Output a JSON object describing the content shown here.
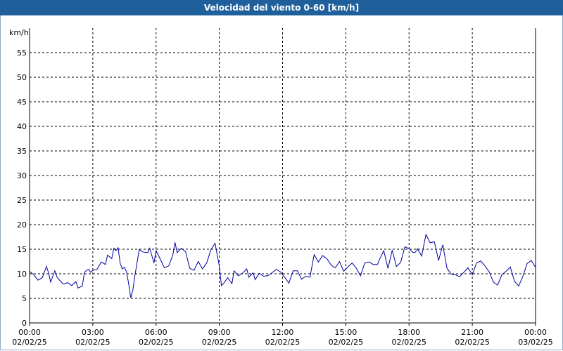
{
  "window": {
    "title": "Velocidad del viento 0-60 [km/h]"
  },
  "colors": {
    "title_bar": "#1f5f9b",
    "series": "#0000a0",
    "grid": "#000000",
    "background": "#ffffff"
  },
  "chart_data": {
    "type": "line",
    "title": "Velocidad del viento 0-60 [km/h]",
    "ylabel": "km/h",
    "ylim": [
      0,
      60
    ],
    "y_ticks": [
      "0",
      "5",
      "10",
      "15",
      "20",
      "25",
      "30",
      "35",
      "40",
      "45",
      "50",
      "55"
    ],
    "x_ticks": [
      {
        "time": "00:00",
        "date": "02/02/25"
      },
      {
        "time": "03:00",
        "date": "02/02/25"
      },
      {
        "time": "06:00",
        "date": "02/02/25"
      },
      {
        "time": "09:00",
        "date": "02/02/25"
      },
      {
        "time": "12:00",
        "date": "02/02/25"
      },
      {
        "time": "15:00",
        "date": "02/02/25"
      },
      {
        "time": "18:00",
        "date": "02/02/25"
      },
      {
        "time": "21:00",
        "date": "02/02/25"
      },
      {
        "time": "00:00",
        "date": "03/02/25"
      }
    ],
    "grid": true,
    "xlim_hours": [
      0,
      24
    ],
    "series": [
      {
        "x_hours": [
          0.0,
          0.2,
          0.4,
          0.6,
          0.8,
          0.9,
          1.0,
          1.2,
          1.3,
          1.4,
          1.6,
          1.8,
          2.0,
          2.2,
          2.3,
          2.5,
          2.6,
          2.7,
          2.8,
          2.9,
          3.0,
          3.2,
          3.4,
          3.6,
          3.7,
          3.9,
          4.0,
          4.1,
          4.2,
          4.3,
          4.4,
          4.5,
          4.6,
          4.7,
          4.8,
          4.9,
          5.0,
          5.2,
          5.4,
          5.6,
          5.7,
          5.9,
          6.0,
          6.2,
          6.4,
          6.6,
          6.8,
          6.9,
          7.0,
          7.2,
          7.4,
          7.6,
          7.8,
          8.0,
          8.2,
          8.4,
          8.6,
          8.8,
          9.0,
          9.1,
          9.2,
          9.4,
          9.6,
          9.7,
          9.9,
          10.1,
          10.3,
          10.4,
          10.6,
          10.7,
          10.9,
          11.1,
          11.3,
          11.5,
          11.7,
          11.9,
          12.1,
          12.3,
          12.5,
          12.7,
          12.9,
          13.1,
          13.3,
          13.5,
          13.7,
          13.9,
          14.1,
          14.3,
          14.5,
          14.7,
          14.9,
          15.1,
          15.3,
          15.5,
          15.7,
          15.9,
          16.1,
          16.3,
          16.5,
          16.6,
          16.8,
          17.0,
          17.2,
          17.4,
          17.6,
          17.8,
          18.0,
          18.2,
          18.3,
          18.4,
          18.6,
          18.8,
          19.0,
          19.2,
          19.4,
          19.6,
          19.8,
          20.0,
          20.2,
          20.4,
          20.6,
          20.8,
          21.0,
          21.2,
          21.4,
          21.6,
          21.8,
          22.0,
          22.2,
          22.4,
          22.6,
          22.8,
          23.0,
          23.2,
          23.4,
          23.6,
          23.8,
          24.0
        ],
        "values": [
          10.5,
          9.8,
          8.7,
          9.2,
          11.5,
          10.2,
          8.3,
          10.6,
          9.4,
          8.8,
          7.9,
          8.2,
          7.6,
          8.4,
          7.1,
          7.5,
          10.2,
          10.7,
          10.9,
          10.3,
          10.7,
          10.9,
          12.4,
          11.9,
          13.8,
          13.1,
          15.2,
          14.7,
          15.3,
          12.1,
          11.0,
          11.3,
          10.4,
          8.0,
          5.1,
          6.7,
          9.7,
          14.9,
          14.4,
          14.3,
          15.2,
          12.2,
          14.7,
          13.0,
          11.2,
          11.6,
          13.9,
          16.4,
          14.3,
          15.2,
          14.5,
          11.1,
          10.7,
          12.5,
          11.0,
          12.2,
          14.9,
          16.2,
          11.6,
          7.6,
          8.0,
          9.2,
          8.0,
          10.6,
          9.6,
          10.1,
          11.0,
          9.3,
          10.2,
          8.8,
          10.1,
          9.5,
          9.6,
          10.2,
          10.9,
          10.4,
          9.3,
          8.1,
          10.6,
          10.6,
          8.9,
          9.5,
          9.3,
          13.9,
          12.4,
          13.7,
          13.1,
          11.8,
          11.2,
          12.5,
          10.5,
          11.4,
          12.2,
          11.1,
          9.6,
          12.2,
          12.4,
          11.9,
          11.9,
          12.9,
          14.7,
          11.1,
          14.8,
          11.5,
          12.3,
          15.5,
          15.1,
          14.3,
          14.4,
          15.1,
          13.6,
          18.0,
          16.3,
          16.5,
          12.7,
          15.9,
          11.1,
          9.9,
          9.8,
          9.4,
          10.3,
          11.2,
          9.8,
          12.2,
          12.6,
          11.6,
          10.4,
          8.3,
          7.7,
          9.8,
          10.5,
          11.4,
          8.5,
          7.5,
          9.5,
          12.1,
          12.7,
          11.3,
          13.0,
          11.9,
          11.0,
          11.7
        ]
      }
    ]
  }
}
